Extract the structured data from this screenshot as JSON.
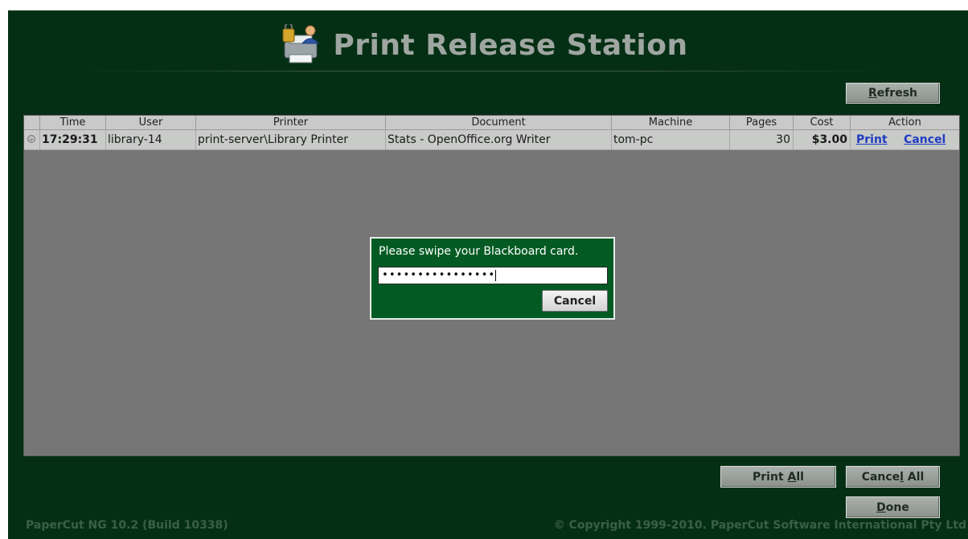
{
  "app": {
    "title": "Print Release Station",
    "logo_icon": "printer-lock-user-icon"
  },
  "toolbar": {
    "refresh_label": "Refresh",
    "refresh_access_key": "R"
  },
  "table": {
    "columns": [
      "Time",
      "User",
      "Printer",
      "Document",
      "Machine",
      "Pages",
      "Cost",
      "Action"
    ],
    "rows": [
      {
        "time": "17:29:31",
        "user": "library-14",
        "printer": "print-server\\Library Printer",
        "document": "Stats - OpenOffice.org Writer",
        "machine": "tom-pc",
        "pages": "30",
        "cost": "$3.00",
        "action_print": "Print",
        "action_cancel": "Cancel"
      }
    ]
  },
  "dialog": {
    "prompt": "Please swipe your Blackboard card.",
    "input_value": "••••••••••••••••",
    "cancel_label": "Cancel"
  },
  "bottom_buttons": {
    "print_all_label": "Print All",
    "print_all_pre": "Print ",
    "print_all_key": "A",
    "print_all_post": "ll",
    "cancel_all_pre": "Cance",
    "cancel_all_key": "l",
    "cancel_all_post": " All",
    "done_key": "D",
    "done_post": "one"
  },
  "footer": {
    "version": "PaperCut NG 10.2 (Build 10338)",
    "copyright": "© Copyright 1999-2010. PaperCut Software International Pty Ltd"
  },
  "colors": {
    "background": "#052f14",
    "dialog_background": "#035b23",
    "link": "#1f3cc0",
    "table_background": "#767676"
  }
}
